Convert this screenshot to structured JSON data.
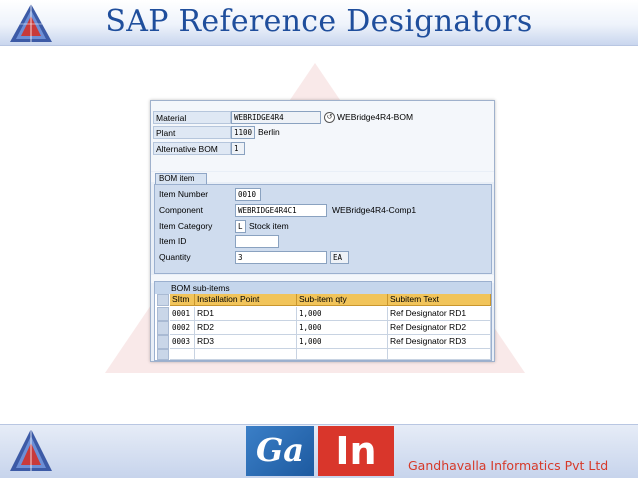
{
  "slide": {
    "title": "SAP Reference Designators",
    "company": "Gandhavalla Informatics Pvt Ltd",
    "brand_left": "Ga",
    "brand_right": "In"
  },
  "header": {
    "material_label": "Material",
    "material_value": "WEBRIDGE4R4",
    "material_desc": "WEBridge4R4-BOM",
    "plant_label": "Plant",
    "plant_value": "1100",
    "plant_desc": "Berlin",
    "alt_bom_label": "Alternative BOM",
    "alt_bom_value": "1"
  },
  "bom_item": {
    "tab_label": "BOM item",
    "item_number_label": "Item Number",
    "item_number_value": "0010",
    "component_label": "Component",
    "component_value": "WEBRIDGE4R4C1",
    "component_desc": "WEBridge4R4-Comp1",
    "item_category_label": "Item Category",
    "item_category_value": "L",
    "item_category_desc": "Stock item",
    "item_id_label": "Item ID",
    "item_id_value": "",
    "quantity_label": "Quantity",
    "quantity_value": "3",
    "unit_value": "EA"
  },
  "sub_items": {
    "title": "BOM sub-items",
    "columns": [
      "SItm",
      "Installation Point",
      "Sub-item qty",
      "Subitem Text"
    ],
    "rows": [
      [
        "0001",
        "RD1",
        "1,000",
        "Ref Designator RD1"
      ],
      [
        "0002",
        "RD2",
        "1,000",
        "Ref Designator RD2"
      ],
      [
        "0003",
        "RD3",
        "1,000",
        "Ref Designator RD3"
      ]
    ]
  }
}
